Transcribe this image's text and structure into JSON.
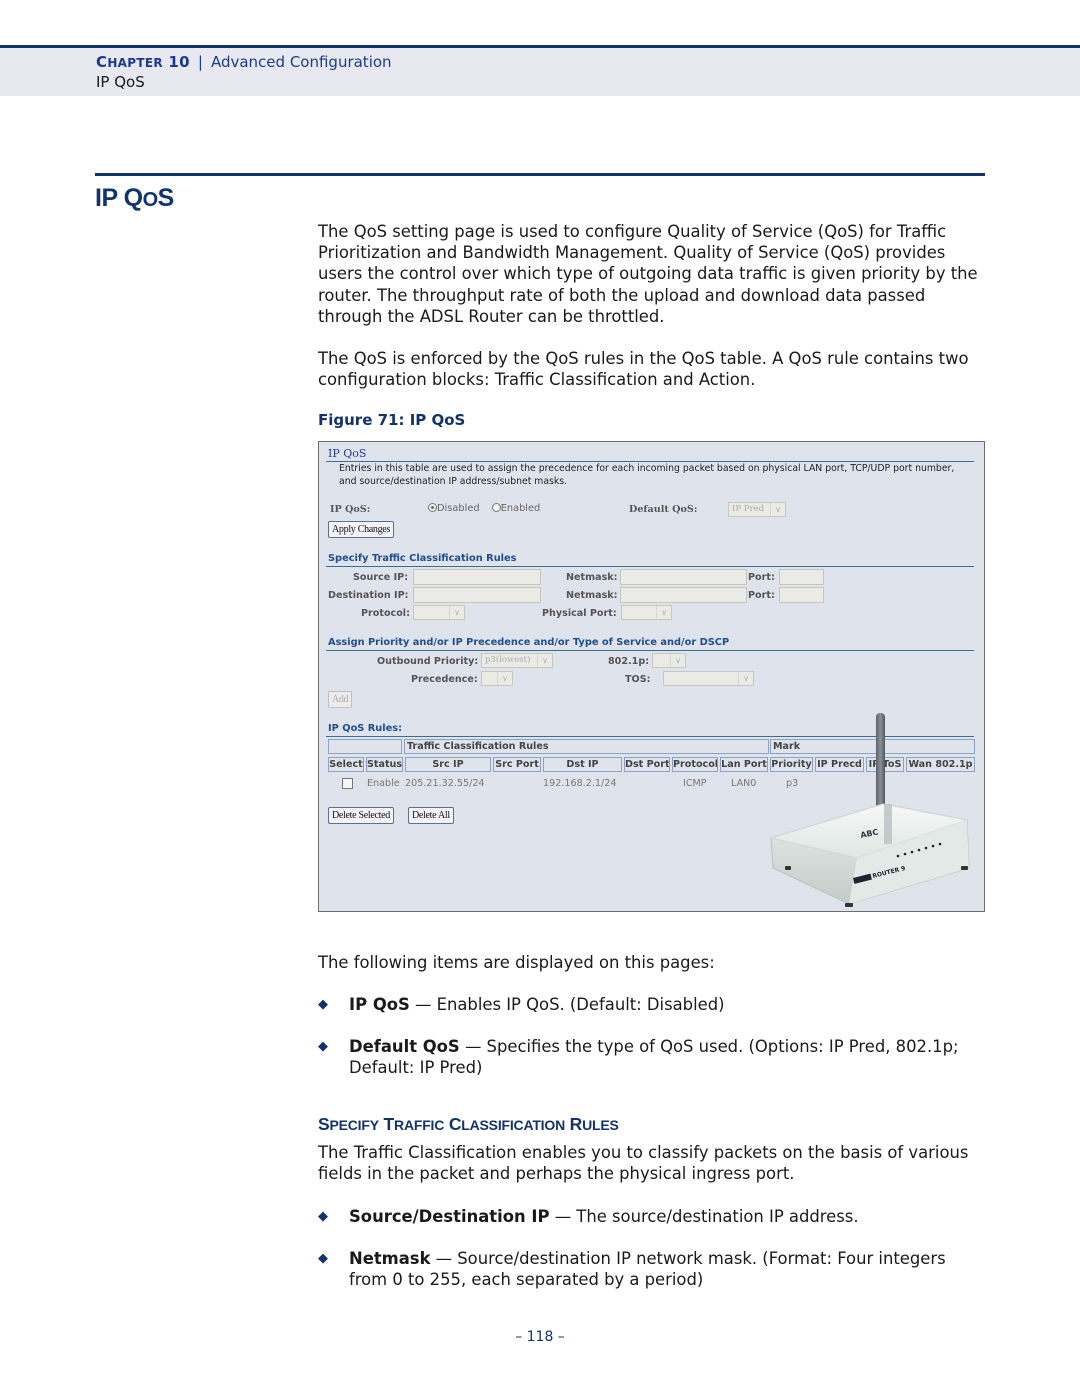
{
  "header": {
    "chapter_prefix": "C",
    "chapter_rest": "HAPTER",
    "chapter_number": "10",
    "separator": "|",
    "chapter_title": "Advanced Configuration",
    "section": "IP QoS"
  },
  "section_title": {
    "first": "IP Q",
    "small": "O",
    "last": "S"
  },
  "paragraphs": {
    "intro": "The QoS setting page is used to configure Quality of Service (QoS) for Traffic Prioritization and Bandwidth Management. Quality of Service (QoS) provides users the control over which type of outgoing data traffic is given priority by the router. The throughput rate of both the upload and download data passed through the ADSL Router can be throttled.",
    "enforced": "The QoS is enforced by the QoS rules in the QoS table. A QoS rule contains two configuration blocks:  Traffic Classification and Action.",
    "following": "The following items are displayed on this pages:",
    "traffic_class": "The Traffic Classification enables you to classify packets on the basis of various fields in the packet and perhaps the physical ingress port."
  },
  "figure": {
    "caption": "Figure 71:  IP QoS",
    "title": "IP QoS",
    "description": "Entries in this table are used to assign the precedence for each incoming packet based on physical LAN port, TCP/UDP port number, and source/destination IP address/subnet masks.",
    "ipqos_label": "IP QoS:",
    "radio_options": [
      {
        "label": "Disabled",
        "selected": true
      },
      {
        "label": "Enabled",
        "selected": false
      }
    ],
    "default_qos_label": "Default QoS:",
    "default_qos_value": "IP Pred",
    "apply_button": "Apply Changes",
    "classification": {
      "heading": "Specify Traffic Classification Rules",
      "source_ip_label": "Source IP:",
      "destination_ip_label": "Destination IP:",
      "netmask_label": "Netmask:",
      "port_label": "Port:",
      "protocol_label": "Protocol:",
      "physical_port_label": "Physical Port:",
      "source_ip": "",
      "destination_ip": "",
      "source_netmask": "",
      "destination_netmask": "",
      "source_port": "",
      "destination_port": ""
    },
    "priority": {
      "heading": "Assign Priority and/or IP Precedence and/or Type of Service and/or DSCP",
      "outbound_label": "Outbound Priority:",
      "outbound_value": "p3(lowest)",
      "dot1p_label": "802.1p:",
      "precedence_label": "Precedence:",
      "tos_label": "TOS:",
      "add_button": "Add"
    },
    "rules": {
      "heading": "IP QoS Rules:",
      "group_headers": [
        "",
        "Traffic Classification Rules",
        "Mark"
      ],
      "columns": [
        "Select",
        "Status",
        "Src IP",
        "Src Port",
        "Dst IP",
        "Dst Port",
        "Protocol",
        "Lan Port",
        "Priority",
        "IP Precd",
        "IP ToS",
        "Wan 802.1p"
      ],
      "rows": [
        {
          "selected": false,
          "status": "Enable",
          "src_ip": "205.21.32.55/24",
          "src_port": "",
          "dst_ip": "192.168.2.1/24",
          "dst_port": "",
          "protocol": "ICMP",
          "lan_port": "LAN0",
          "priority": "p3",
          "ip_precd": "",
          "ip_tos": "",
          "wan_8021p": ""
        }
      ],
      "delete_selected": "Delete Selected",
      "delete_all": "Delete All"
    },
    "router_image": "wireless-router-illustration"
  },
  "bullets": [
    {
      "term": "IP QoS",
      "text": " — Enables IP QoS. (Default: Disabled)"
    },
    {
      "term": "Default QoS",
      "text": " — Specifies the type of QoS used. (Options: IP Pred, 802.1p; Default: IP Pred)"
    },
    {
      "term": "Source/Destination IP",
      "text": " — The source/destination IP address."
    },
    {
      "term": "Netmask",
      "text": " — Source/destination IP network mask. (Format: Four integers from 0 to 255, each separated by a period)"
    }
  ],
  "subsection_title": {
    "w1_first": "S",
    "w1_rest": "PECIFY",
    "w2_first": "T",
    "w2_rest": "RAFFIC",
    "w3_first": "C",
    "w3_rest": "LASSIFICATION",
    "w4_first": "R",
    "w4_rest": "ULES"
  },
  "bullet_glyph": "◆",
  "page_number": "–  118  –",
  "colors": {
    "brand_blue": "#13336f",
    "header_band": "#e8e9f0",
    "figure_bg": "#dfe3ec",
    "link_blue": "#1f4e8c"
  }
}
